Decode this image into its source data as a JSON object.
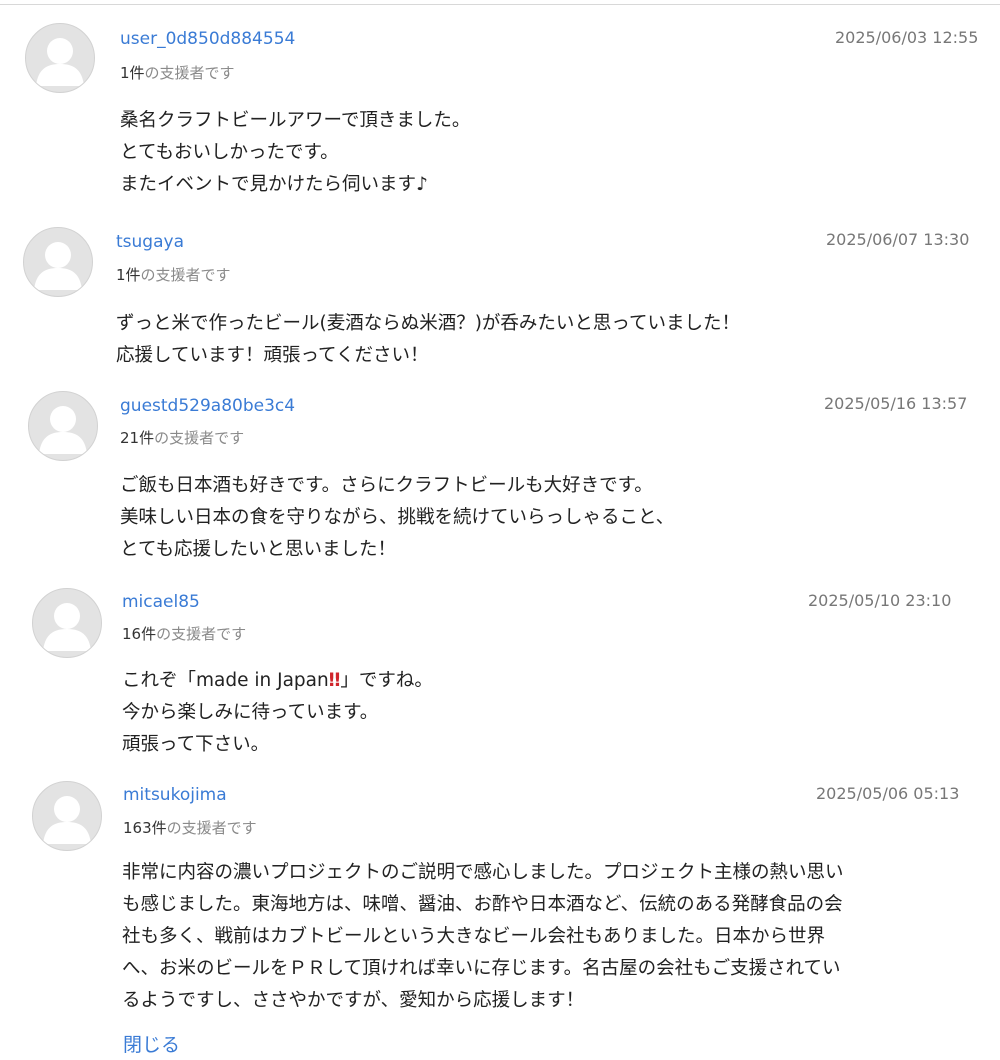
{
  "comments": [
    {
      "username": "user_0d850d884554",
      "count": "1件",
      "count_suffix": "の支援者です",
      "date": "2025/06/03 12:55",
      "lines": [
        "桑名クラフトビールアワーで頂きました。",
        "とてもおいしかったです。",
        "またイベントで見かけたら伺います♪"
      ]
    },
    {
      "username": "tsugaya",
      "count": "1件",
      "count_suffix": "の支援者です",
      "date": "2025/06/07 13:30",
      "lines": [
        "ずっと米で作ったビール(麦酒ならぬ米酒？)が呑みたいと思っていました！",
        "応援しています！頑張ってください！"
      ]
    },
    {
      "username": "guestd529a80be3c4",
      "count": "21件",
      "count_suffix": "の支援者です",
      "date": "2025/05/16 13:57",
      "lines": [
        "ご飯も日本酒も好きです。さらにクラフトビールも大好きです。",
        "美味しい日本の食を守りながら、挑戦を続けていらっしゃること、",
        "とても応援したいと思いました！"
      ]
    },
    {
      "username": "micael85",
      "count": "16件",
      "count_suffix": "の支援者です",
      "date": "2025/05/10 23:10",
      "line1_pre": "これぞ「made in Japan",
      "line1_emph": "‼",
      "line1_post": "」ですね。",
      "lines": [
        "今から楽しみに待っています。",
        "頑張って下さい。"
      ]
    },
    {
      "username": "mitsukojima",
      "count": "163件",
      "count_suffix": "の支援者です",
      "date": "2025/05/06 05:13",
      "lines": [
        "非常に内容の濃いプロジェクトのご説明で感心しました。プロジェクト主様の熱い思い",
        "も感じました。東海地方は、味噌、醤油、お酢や日本酒など、伝統のある発酵食品の会",
        "社も多く、戦前はカブトビールという大きなビール会社もありました。日本から世界",
        "へ、お米のビールをＰＲして頂ければ幸いに存じます。名古屋の会社もご支援されてい",
        "るようですし、ささやかですが、愛知から応援します！"
      ],
      "close_label": "閉じる"
    }
  ]
}
